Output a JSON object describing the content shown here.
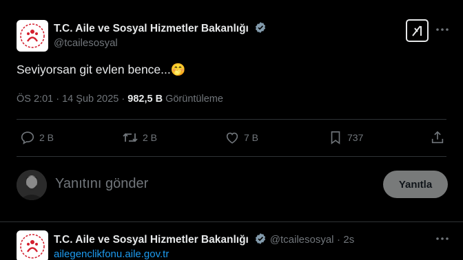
{
  "tweet": {
    "author_name": "T.C. Aile ve Sosyal Hizmetler Bakanlığı",
    "handle": "@tcailesosyal",
    "text": "Seviyorsan git evlen bence...",
    "emoji": "🤭",
    "time": "ÖS 2:01",
    "dot": "·",
    "date": "14 Şub 2025",
    "views_count": "982,5 B",
    "views_label": "Görüntüleme"
  },
  "actions": {
    "replies": "2 B",
    "reposts": "2 B",
    "likes": "7 B",
    "bookmarks": "737"
  },
  "reply_box": {
    "placeholder": "Yanıtını gönder",
    "button_label": "Yanıtla"
  },
  "next_tweet": {
    "author_name": "T.C. Aile ve Sosyal Hizmetler Bakanlığı",
    "handle": "@tcailesosyal",
    "dot": "·",
    "age": "2s",
    "link": "ailegenclikfonu.aile.gov.tr"
  },
  "icons": {
    "grok": "grok-icon",
    "more": "more-icon",
    "verified": "verified-badge-icon",
    "reply": "reply-icon",
    "repost": "repost-icon",
    "like": "heart-icon",
    "bookmark": "bookmark-icon",
    "share": "share-icon"
  },
  "colors": {
    "background": "#000000",
    "text": "#e7e9ea",
    "muted": "#71767b",
    "link": "#1d9bf0",
    "emblem_red": "#d4202f",
    "button": "#787a7a"
  }
}
